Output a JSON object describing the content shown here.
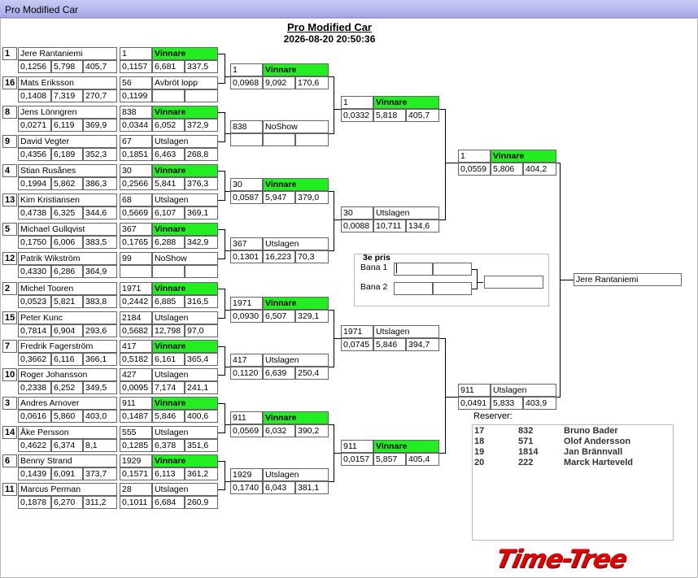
{
  "window": {
    "title": "Pro Modified Car"
  },
  "header": {
    "title": "Pro Modified Car",
    "datetime": "2026-08-20 20:50:36"
  },
  "round1": [
    {
      "seed": "1",
      "name": "Jere Rantaniemi",
      "rt": "0,1256",
      "et": "5,798",
      "speed": "405,7",
      "opp_no": "1",
      "result": "Vinnare",
      "winner": true,
      "rt2": "0,1157",
      "et2": "6,681",
      "speed2": "337,5"
    },
    {
      "seed": "16",
      "name": "Mats Eriksson",
      "rt": "0,1408",
      "et": "7,319",
      "speed": "270,7",
      "opp_no": "56",
      "result": "Avbröt lopp",
      "winner": false,
      "rt2": "0,1199",
      "et2": "",
      "speed2": ""
    },
    {
      "seed": "8",
      "name": "Jens Lönngren",
      "rt": "0,0271",
      "et": "6,119",
      "speed": "369,9",
      "opp_no": "838",
      "result": "Vinnare",
      "winner": true,
      "rt2": "0,0344",
      "et2": "6,052",
      "speed2": "372,9"
    },
    {
      "seed": "9",
      "name": "David Vegter",
      "rt": "0,4356",
      "et": "6,189",
      "speed": "352,3",
      "opp_no": "67",
      "result": "Utslagen",
      "winner": false,
      "rt2": "0,1851",
      "et2": "6,463",
      "speed2": "268,8"
    },
    {
      "seed": "4",
      "name": "Stian Rusånes",
      "rt": "0,1994",
      "et": "5,862",
      "speed": "386,3",
      "opp_no": "30",
      "result": "Vinnare",
      "winner": true,
      "rt2": "0,2566",
      "et2": "5,841",
      "speed2": "376,3"
    },
    {
      "seed": "13",
      "name": "Kim Kristiansen",
      "rt": "0,4738",
      "et": "6,325",
      "speed": "344,6",
      "opp_no": "68",
      "result": "Utslagen",
      "winner": false,
      "rt2": "0,5669",
      "et2": "6,107",
      "speed2": "369,1"
    },
    {
      "seed": "5",
      "name": "Michael Gullqvist",
      "rt": "0,1750",
      "et": "6,006",
      "speed": "383,5",
      "opp_no": "367",
      "result": "Vinnare",
      "winner": true,
      "rt2": "0,1765",
      "et2": "6,288",
      "speed2": "342,9"
    },
    {
      "seed": "12",
      "name": "Patrik Wikström",
      "rt": "0,4330",
      "et": "6,286",
      "speed": "364,9",
      "opp_no": "99",
      "result": "NoShow",
      "winner": false,
      "rt2": "",
      "et2": "",
      "speed2": ""
    },
    {
      "seed": "2",
      "name": "Michel Tooren",
      "rt": "0,0523",
      "et": "5,821",
      "speed": "383,8",
      "opp_no": "1971",
      "result": "Vinnare",
      "winner": true,
      "rt2": "0,2442",
      "et2": "6,885",
      "speed2": "316,5"
    },
    {
      "seed": "15",
      "name": "Peter  Kunc",
      "rt": "0,7814",
      "et": "6,904",
      "speed": "293,6",
      "opp_no": "2184",
      "result": "Utslagen",
      "winner": false,
      "rt2": "0,5682",
      "et2": "12,798",
      "speed2": "97,0"
    },
    {
      "seed": "7",
      "name": "Fredrik Fagerström",
      "rt": "0,3662",
      "et": "6,116",
      "speed": "366,1",
      "opp_no": "417",
      "result": "Vinnare",
      "winner": true,
      "rt2": "0,5182",
      "et2": "6,161",
      "speed2": "365,4"
    },
    {
      "seed": "10",
      "name": "Roger Johansson",
      "rt": "0,2338",
      "et": "6,252",
      "speed": "349,5",
      "opp_no": "427",
      "result": "Utslagen",
      "winner": false,
      "rt2": "0,0095",
      "et2": "7,174",
      "speed2": "241,1"
    },
    {
      "seed": "3",
      "name": "Andres Arnover",
      "rt": "0,0616",
      "et": "5,860",
      "speed": "403,0",
      "opp_no": "911",
      "result": "Vinnare",
      "winner": true,
      "rt2": "0,1487",
      "et2": "5,846",
      "speed2": "400,6"
    },
    {
      "seed": "14",
      "name": "Åke Persson",
      "rt": "0,4622",
      "et": "6,374",
      "speed": "8,1",
      "opp_no": "555",
      "result": "Utslagen",
      "winner": false,
      "rt2": "0,1285",
      "et2": "6,378",
      "speed2": "351,6"
    },
    {
      "seed": "6",
      "name": "Benny Strand",
      "rt": "0,1439",
      "et": "6,091",
      "speed": "373,7",
      "opp_no": "1929",
      "result": "Vinnare",
      "winner": true,
      "rt2": "0,1571",
      "et2": "6,113",
      "speed2": "361,2"
    },
    {
      "seed": "11",
      "name": "Marcus Perman",
      "rt": "0,1878",
      "et": "6,270",
      "speed": "311,2",
      "opp_no": "28",
      "result": "Utslagen",
      "winner": false,
      "rt2": "0,1011",
      "et2": "6,684",
      "speed2": "260,9"
    }
  ],
  "quarter": [
    {
      "no": "1",
      "result": "Vinnare",
      "winner": true,
      "rt": "0,0968",
      "et": "9,092",
      "speed": "170,6"
    },
    {
      "no": "838",
      "result": "NoShow",
      "winner": false,
      "rt": "",
      "et": "",
      "speed": ""
    },
    {
      "no": "30",
      "result": "Vinnare",
      "winner": true,
      "rt": "0,0587",
      "et": "5,947",
      "speed": "379,0"
    },
    {
      "no": "367",
      "result": "Utslagen",
      "winner": false,
      "rt": "0,1301",
      "et": "16,223",
      "speed": "70,3"
    },
    {
      "no": "1971",
      "result": "Vinnare",
      "winner": true,
      "rt": "0,0930",
      "et": "6,507",
      "speed": "329,1"
    },
    {
      "no": "417",
      "result": "Utslagen",
      "winner": false,
      "rt": "0,1120",
      "et": "6,639",
      "speed": "250,4"
    },
    {
      "no": "911",
      "result": "Vinnare",
      "winner": true,
      "rt": "0,0569",
      "et": "6,032",
      "speed": "390,2"
    },
    {
      "no": "1929",
      "result": "Utslagen",
      "winner": false,
      "rt": "0,1740",
      "et": "6,043",
      "speed": "381,1"
    }
  ],
  "semi": [
    {
      "no": "1",
      "result": "Vinnare",
      "winner": true,
      "rt": "0,0332",
      "et": "5,818",
      "speed": "405,7"
    },
    {
      "no": "30",
      "result": "Utslagen",
      "winner": false,
      "rt": "0,0088",
      "et": "10,711",
      "speed": "134,6"
    },
    {
      "no": "1971",
      "result": "Utslagen",
      "winner": false,
      "rt": "0,0745",
      "et": "5,846",
      "speed": "394,7"
    },
    {
      "no": "911",
      "result": "Vinnare",
      "winner": true,
      "rt": "0,0157",
      "et": "5,857",
      "speed": "405,4"
    }
  ],
  "final": [
    {
      "no": "1",
      "result": "Vinnare",
      "winner": true,
      "rt": "0,0559",
      "et": "5,806",
      "speed": "404,2"
    },
    {
      "no": "911",
      "result": "Utslagen",
      "winner": false,
      "rt": "0,0491",
      "et": "5,833",
      "speed": "403,9"
    }
  ],
  "champion": "Jere Rantaniemi",
  "third_place": {
    "title": "3e pris",
    "lane1": "Bana 1",
    "lane2": "Bana 2"
  },
  "reserves": {
    "title": "Reserver:",
    "rows": [
      {
        "seed": "17",
        "no": "832",
        "name": "Bruno Bader"
      },
      {
        "seed": "18",
        "no": "571",
        "name": "Olof Andersson"
      },
      {
        "seed": "19",
        "no": "1814",
        "name": "Jan Brännvall"
      },
      {
        "seed": "20",
        "no": "222",
        "name": "Marck Harteveld"
      }
    ]
  },
  "logo": "Time-Tree"
}
